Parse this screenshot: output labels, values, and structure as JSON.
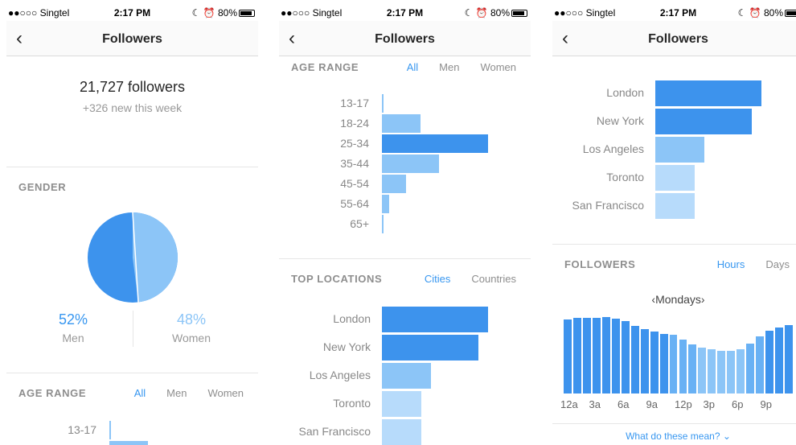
{
  "status": {
    "carrier": "●●○○○ Singtel",
    "time": "2:17 PM",
    "battery": "80%"
  },
  "nav": {
    "title": "Followers",
    "back": "‹"
  },
  "overview": {
    "total": "21,727 followers",
    "new": "+326 new this week"
  },
  "gender": {
    "heading": "GENDER",
    "men_pct": "52%",
    "men_label": "Men",
    "women_pct": "48%",
    "women_label": "Women",
    "men_share": 0.52
  },
  "age": {
    "heading": "AGE RANGE",
    "tabs": [
      "All",
      "Men",
      "Women"
    ],
    "active_tab": "All",
    "ranges": [
      {
        "label": "13-17",
        "value": 0.015
      },
      {
        "label": "18-24",
        "value": 0.36
      },
      {
        "label": "25-34",
        "value": 1.0
      },
      {
        "label": "35-44",
        "value": 0.54
      },
      {
        "label": "45-54",
        "value": 0.23
      },
      {
        "label": "55-64",
        "value": 0.07
      },
      {
        "label": "65+",
        "value": 0.015
      }
    ]
  },
  "locations": {
    "heading": "TOP LOCATIONS",
    "tabs": [
      "Cities",
      "Countries"
    ],
    "active_tab": "Cities",
    "cities": [
      {
        "label": "London",
        "value": 1.0
      },
      {
        "label": "New York",
        "value": 0.91
      },
      {
        "label": "Los Angeles",
        "value": 0.46
      },
      {
        "label": "Toronto",
        "value": 0.37
      },
      {
        "label": "San Francisco",
        "value": 0.37
      }
    ]
  },
  "followers_time": {
    "heading": "FOLLOWERS",
    "tabs": [
      "Hours",
      "Days"
    ],
    "active_tab": "Hours",
    "day": "‹Mondays›",
    "hour_labels": [
      "12a",
      "3a",
      "6a",
      "9a",
      "12p",
      "3p",
      "6p",
      "9p"
    ],
    "values": [
      0.94,
      0.96,
      0.96,
      0.96,
      0.97,
      0.95,
      0.92,
      0.86,
      0.82,
      0.79,
      0.76,
      0.74,
      0.68,
      0.62,
      0.58,
      0.56,
      0.54,
      0.54,
      0.56,
      0.63,
      0.72,
      0.8,
      0.84,
      0.87
    ],
    "help": "What do these mean? ⌄"
  },
  "colors": {
    "strong": "#3d93ed",
    "mid": "#8cc5f7",
    "light": "#b7dbfb",
    "accent": "#3897f0"
  }
}
